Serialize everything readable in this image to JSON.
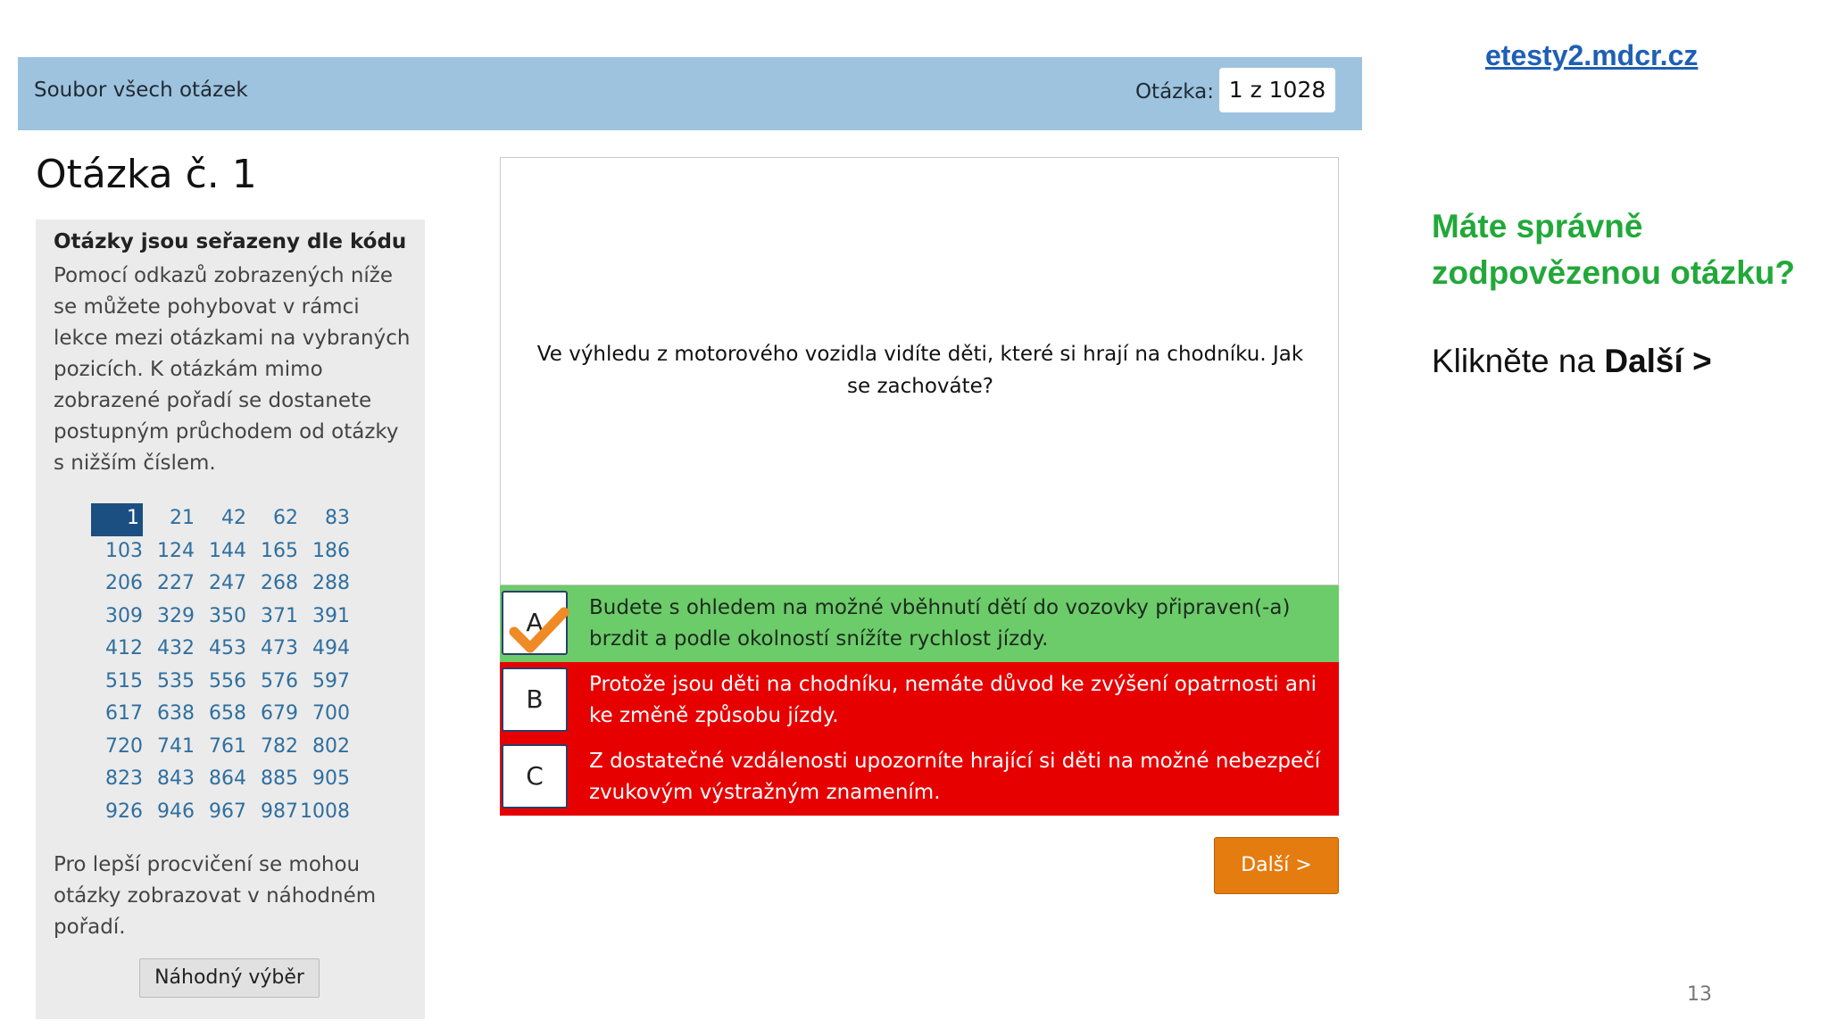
{
  "header": {
    "title": "Soubor všech otázek",
    "question_label": "Otázka:",
    "question_counter": "1 z 1028"
  },
  "site_link": "etesty2.mdcr.cz",
  "page_title": "Otázka č. 1",
  "sidebar": {
    "heading": "Otázky jsou seřazeny dle kódu",
    "intro": "Pomocí odkazů zobrazených níže se můžete pohybovat v rámci lekce mezi otázkami na vybraných pozicích. K otázkám mimo zobrazené pořadí se dostanete postupným průchodem od otázky s nižším číslem.",
    "active_number": "1",
    "numbers": [
      [
        "1",
        "21",
        "42",
        "62",
        "83"
      ],
      [
        "103",
        "124",
        "144",
        "165",
        "186"
      ],
      [
        "206",
        "227",
        "247",
        "268",
        "288"
      ],
      [
        "309",
        "329",
        "350",
        "371",
        "391"
      ],
      [
        "412",
        "432",
        "453",
        "473",
        "494"
      ],
      [
        "515",
        "535",
        "556",
        "576",
        "597"
      ],
      [
        "617",
        "638",
        "658",
        "679",
        "700"
      ],
      [
        "720",
        "741",
        "761",
        "782",
        "802"
      ],
      [
        "823",
        "843",
        "864",
        "885",
        "905"
      ],
      [
        "926",
        "946",
        "967",
        "987",
        "1008"
      ]
    ],
    "random_text": "Pro lepší procvičení se mohou otázky zobrazovat v náhodném pořadí.",
    "random_button": "Náhodný výběr"
  },
  "question": {
    "text": "Ve výhledu z motorového vozidla vidíte děti, které si hrají na chodníku. Jak se zachováte?"
  },
  "answers": [
    {
      "letter": "A",
      "text": "Budete s ohledem na možné vběhnutí dětí do vozovky připraven(-a) brzdit a podle okolností snížíte rychlost jízdy.",
      "status": "correct"
    },
    {
      "letter": "B",
      "text": "Protože jsou děti na chodníku, nemáte důvod ke zvýšení opatrnosti ani ke změně způsobu jízdy.",
      "status": "wrong"
    },
    {
      "letter": "C",
      "text": "Z dostatečné vzdálenosti upozorníte hrající si děti na možné nebezpečí zvukovým výstražným znamením.",
      "status": "wrong"
    }
  ],
  "next_button": "Další >",
  "hint": {
    "question": "Máte správně zodpovězenou otázku?",
    "instruction_prefix": "Klikněte na",
    "instruction_bold": "Další >"
  },
  "page_number": "13",
  "colors": {
    "header_bg": "#9ec3df",
    "correct": "#6ccc6a",
    "wrong": "#e60000",
    "next_button": "#e57c10",
    "hint_green": "#22a83a",
    "checkmark": "#f08a24"
  },
  "icons": {
    "checkmark": "checkmark-icon"
  }
}
